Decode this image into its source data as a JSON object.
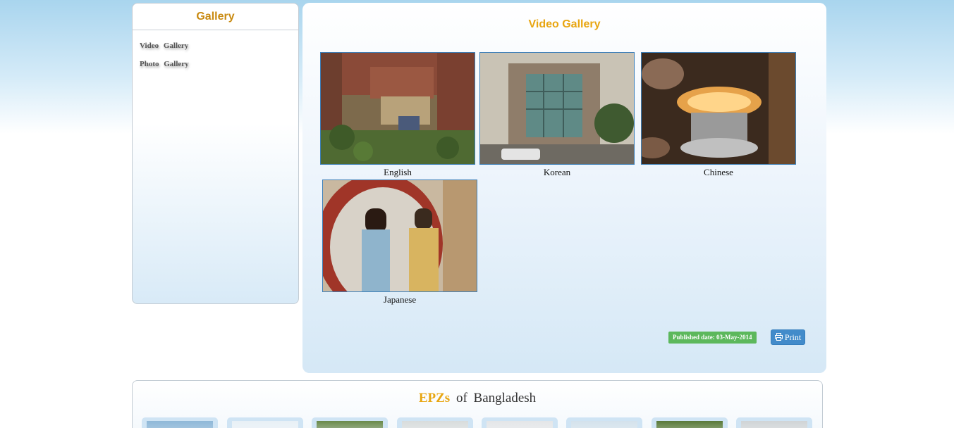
{
  "sidebar": {
    "title": "Gallery",
    "items": [
      {
        "label": "Video  Gallery"
      },
      {
        "label": "Photo  Gallery"
      }
    ]
  },
  "main": {
    "title": "Video Gallery",
    "videos": [
      {
        "caption": "English"
      },
      {
        "caption": "Korean"
      },
      {
        "caption": "Chinese"
      },
      {
        "caption": "Japanese"
      }
    ],
    "published": "Published date: 03-May-2014",
    "print_label": "Print"
  },
  "epz": {
    "title_highlight": "EPZs",
    "title_rest": "of  Bangladesh"
  },
  "colors": {
    "accent_gold": "#e8a611",
    "sidebar_title": "#c98a11",
    "print_button": "#428bca",
    "published_badge": "#5cb85c"
  }
}
